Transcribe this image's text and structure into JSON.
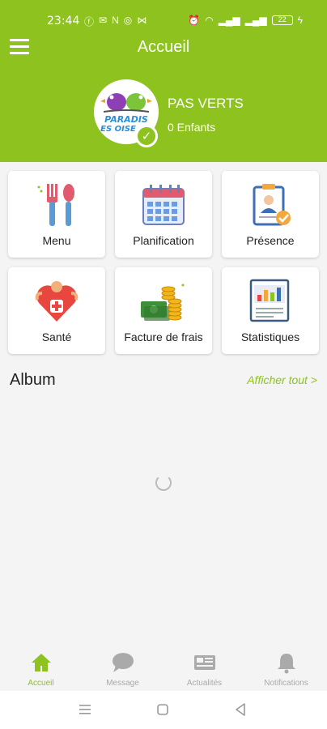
{
  "status_bar": {
    "time": "23:44",
    "battery": "22"
  },
  "header": {
    "title": "Accueil",
    "child_name": "PAS VERTS",
    "child_count": "0 Enfants",
    "logo_text_1": "PARADIS",
    "logo_text_2": "ES OISE"
  },
  "tiles": [
    {
      "label": "Menu",
      "icon": "utensils-icon"
    },
    {
      "label": "Planification",
      "icon": "calendar-icon"
    },
    {
      "label": "Présence",
      "icon": "attendance-icon"
    },
    {
      "label": "Santé",
      "icon": "health-icon"
    },
    {
      "label": "Facture de frais",
      "icon": "money-icon"
    },
    {
      "label": "Statistiques",
      "icon": "stats-icon"
    }
  ],
  "album": {
    "title": "Album",
    "view_all": "Afficher tout >"
  },
  "bottom_nav": [
    {
      "label": "Accueil",
      "icon": "home-icon",
      "active": true
    },
    {
      "label": "Message",
      "icon": "chat-icon",
      "active": false
    },
    {
      "label": "Actualités",
      "icon": "news-icon",
      "active": false
    },
    {
      "label": "Notifications",
      "icon": "bell-icon",
      "active": false
    }
  ],
  "colors": {
    "brand": "#8dc21f",
    "inactive": "#aaaaaa"
  }
}
